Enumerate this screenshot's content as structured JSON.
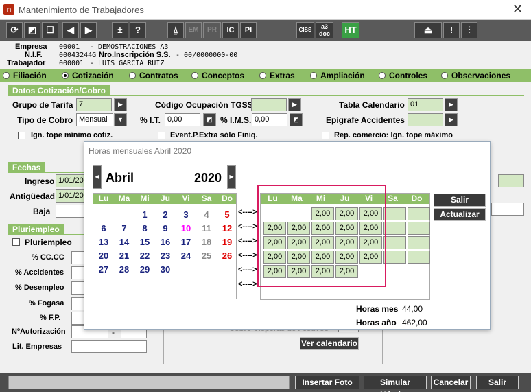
{
  "window": {
    "title": "Mantenimiento de Trabajadores",
    "icon_letter": "n"
  },
  "toolbar": {
    "buttons": [
      {
        "label": "⟳",
        "name": "refresh"
      },
      {
        "label": "◩",
        "name": "edit"
      },
      {
        "label": "☐",
        "name": "new"
      },
      {
        "label": "◀",
        "name": "prev"
      },
      {
        "label": "▶",
        "name": "next"
      },
      {
        "label": "±",
        "name": "plusminus"
      },
      {
        "label": "?",
        "name": "help"
      },
      {
        "label": "⍙",
        "name": "alert"
      },
      {
        "label": "EM",
        "name": "em"
      },
      {
        "label": "PR",
        "name": "pr"
      },
      {
        "label": "IC",
        "name": "ic"
      },
      {
        "label": "PI",
        "name": "pi"
      },
      {
        "label": "CISS",
        "name": "ciss"
      },
      {
        "label": "a3 doc",
        "name": "a3doc"
      },
      {
        "label": "HT",
        "name": "ht"
      },
      {
        "label": "⏏",
        "name": "eject"
      },
      {
        "label": "!",
        "name": "warning"
      },
      {
        "label": "⫶",
        "name": "settings"
      }
    ]
  },
  "header": {
    "empresa_label": "Empresa",
    "empresa_code": "00001",
    "empresa_name": "- DEMOSTRACIONES A3",
    "nif_label": "N.I.F.",
    "nif_value": "00043244G",
    "nro_label": "Nro.Inscripción S.S.",
    "nro_value": "- 00/0000000-00",
    "trabajador_label": "Trabajador",
    "trabajador_code": "000001",
    "trabajador_name": "- LUIS GARCIA RUIZ"
  },
  "tabs": [
    "Filiación",
    "Cotización",
    "Contratos",
    "Conceptos",
    "Extras",
    "Ampliación",
    "Controles",
    "Observaciones"
  ],
  "selected_tab": "Cotización",
  "cotizacion": {
    "section_title": "Datos Cotización/Cobro",
    "grupo_tarifa_label": "Grupo de Tarifa",
    "grupo_tarifa_value": "7",
    "codigo_ocupacion_label": "Código Ocupación TGSS",
    "tabla_calendario_label": "Tabla Calendario",
    "tabla_calendario_value": "01",
    "tipo_cobro_label": "Tipo de Cobro",
    "tipo_cobro_value": "Mensual",
    "it_label": "% I.T.",
    "it_value": "0,00",
    "ims_label": "% I.M.S.",
    "ims_value": "0,00",
    "epigrafe_label": "Epígrafe Accidentes",
    "ign_tope_label": "Ign. tope mínimo cotiz.",
    "event_label": "Event.P.Extra sólo Finiq.",
    "rep_label": "Rep. comercio: Ign. tope máximo"
  },
  "fechas": {
    "section_title": "Fechas",
    "ingreso_label": "Ingreso",
    "ingreso_value": "1/01/20",
    "antiguedad_label": "Antigüedad",
    "antiguedad_value": "1/01/20",
    "baja_label": "Baja"
  },
  "pluriempleo": {
    "section_title": "Pluriempleo",
    "check_label": "Pluriempleo",
    "fields": [
      "% CC.CC",
      "% Accidentes",
      "% Desempleo",
      "% Fogasa",
      "% F.P.",
      "NºAutorización",
      "Lit. Empresas"
    ]
  },
  "behind": {
    "cobro_label": "Cobro Vísperas de Festivos",
    "ver_calendario": "Ver calendario"
  },
  "bottom": {
    "insertar_foto": "Insertar Foto",
    "simular_nomina": "Simular Nómina",
    "cancelar": "Cancelar",
    "salir": "Salir"
  },
  "popup": {
    "title": "Horas mensuales Abril 2020",
    "month": "Abril",
    "year": "2020",
    "weekdays": [
      "Lu",
      "Ma",
      "Mi",
      "Ju",
      "Vi",
      "Sa",
      "Do"
    ],
    "weeks": [
      [
        "",
        "",
        "1",
        "2",
        "3",
        "4",
        "5"
      ],
      [
        "6",
        "7",
        "8",
        "9",
        "10",
        "11",
        "12"
      ],
      [
        "13",
        "14",
        "15",
        "16",
        "17",
        "18",
        "19"
      ],
      [
        "20",
        "21",
        "22",
        "23",
        "24",
        "25",
        "26"
      ],
      [
        "27",
        "28",
        "29",
        "30",
        "",
        "",
        ""
      ]
    ],
    "arrow": "<---->",
    "hours": [
      [
        "",
        "",
        "2,00",
        "2,00",
        "2,00",
        "",
        ""
      ],
      [
        "2,00",
        "2,00",
        "2,00",
        "2,00",
        "2,00",
        "",
        ""
      ],
      [
        "2,00",
        "2,00",
        "2,00",
        "2,00",
        "2,00",
        "",
        ""
      ],
      [
        "2,00",
        "2,00",
        "2,00",
        "2,00",
        "2,00",
        "",
        ""
      ],
      [
        "2,00",
        "2,00",
        "2,00",
        "2,00",
        "",
        "",
        ""
      ]
    ],
    "salir": "Salir",
    "actualizar": "Actualizar",
    "horas_mes_label": "Horas mes",
    "horas_mes_value": "44,00",
    "horas_ano_label": "Horas año",
    "horas_ano_value": "462,00",
    "colors": {
      "weekday": "#1a237e",
      "holiday": "#ff00ff",
      "sunday": "#e00000",
      "saturday": "#888888",
      "highlight": "#d81b60",
      "header": "#8fbf68"
    }
  }
}
